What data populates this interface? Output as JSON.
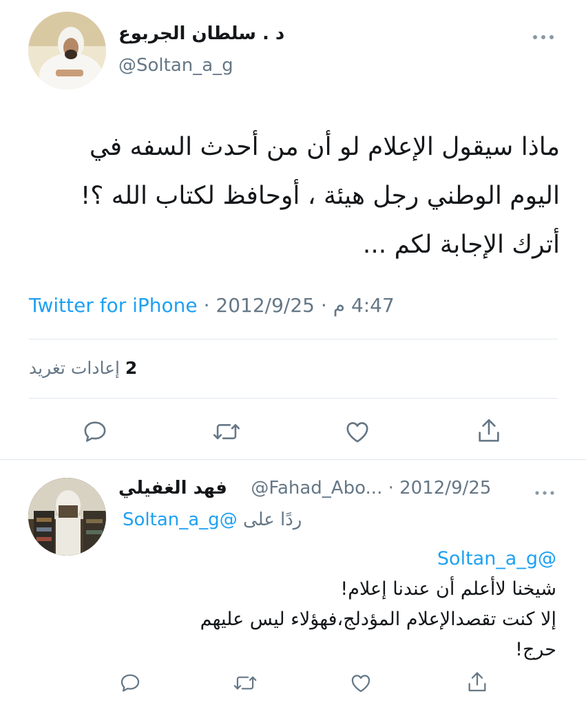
{
  "main_tweet": {
    "display_name": "د . سلطان الجربوع",
    "handle": "@Soltan_a_g",
    "text_lines": [
      "ماذا سيقول الإعلام لو أن من أحدث السفه في",
      "اليوم الوطني رجل هيئة ، أوحافظ لكتاب الله ؟!",
      "أترك الإجابة لكم ..."
    ],
    "meta": {
      "time": "4:47 م",
      "separator": "·",
      "date": "2012/9/25",
      "source": "Twitter for iPhone"
    },
    "retweets": {
      "count": "2",
      "label": "إعادات تغريد"
    }
  },
  "reply": {
    "display_name": "فهد الغفيلي",
    "handle": "@Fahad_Abo...",
    "separator": "·",
    "date": "2012/9/25",
    "replying_prefix": "ردًا على",
    "replying_handle": "@Soltan_a_g",
    "mention": "@Soltan_a_g",
    "text_lines": [
      "شيخنا لاأعلم أن عندنا إعلام!",
      "إلا كنت تقصدالإعلام المؤدلج،فهؤلاء ليس عليهم",
      "حرج!"
    ]
  },
  "colors": {
    "link": "#1da1f2",
    "secondary": "#657786",
    "icon": "#657786",
    "divider": "#e1e8ed"
  },
  "icons": [
    "more-icon",
    "reply-icon",
    "retweet-icon",
    "like-icon",
    "share-icon"
  ]
}
